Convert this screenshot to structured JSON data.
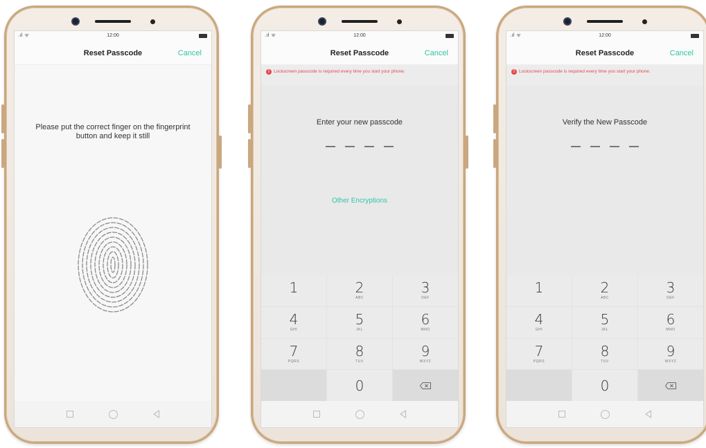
{
  "status": {
    "time": "12:00",
    "signal": ".ıl ᯤ"
  },
  "screens": [
    {
      "nav_title": "Reset Passcode",
      "cancel": "Cancel",
      "instruction": "Please put the correct finger on the fingerprint button and keep it still"
    },
    {
      "nav_title": "Reset Passcode",
      "cancel": "Cancel",
      "warning": "Lockscreen passcode is required every time you start your phone.",
      "prompt": "Enter your new passcode",
      "other_encryptions": "Other Encryptions"
    },
    {
      "nav_title": "Reset Passcode",
      "cancel": "Cancel",
      "warning": "Lockscreen passcode is required every time you start your phone.",
      "prompt": "Verify the New Passcode"
    }
  ],
  "keypad": {
    "keys": [
      {
        "num": "1",
        "letters": ""
      },
      {
        "num": "2",
        "letters": "ABC"
      },
      {
        "num": "3",
        "letters": "DEF"
      },
      {
        "num": "4",
        "letters": "GHI"
      },
      {
        "num": "5",
        "letters": "JKL"
      },
      {
        "num": "6",
        "letters": "MNO"
      },
      {
        "num": "7",
        "letters": "PQRS"
      },
      {
        "num": "8",
        "letters": "TUV"
      },
      {
        "num": "9",
        "letters": "WXYZ"
      },
      {
        "num": "0",
        "letters": ""
      }
    ],
    "backspace_icon": "backspace-icon"
  },
  "colors": {
    "accent": "#2cc6a1",
    "warning": "#e5484d",
    "frame": "#c9a77f"
  }
}
